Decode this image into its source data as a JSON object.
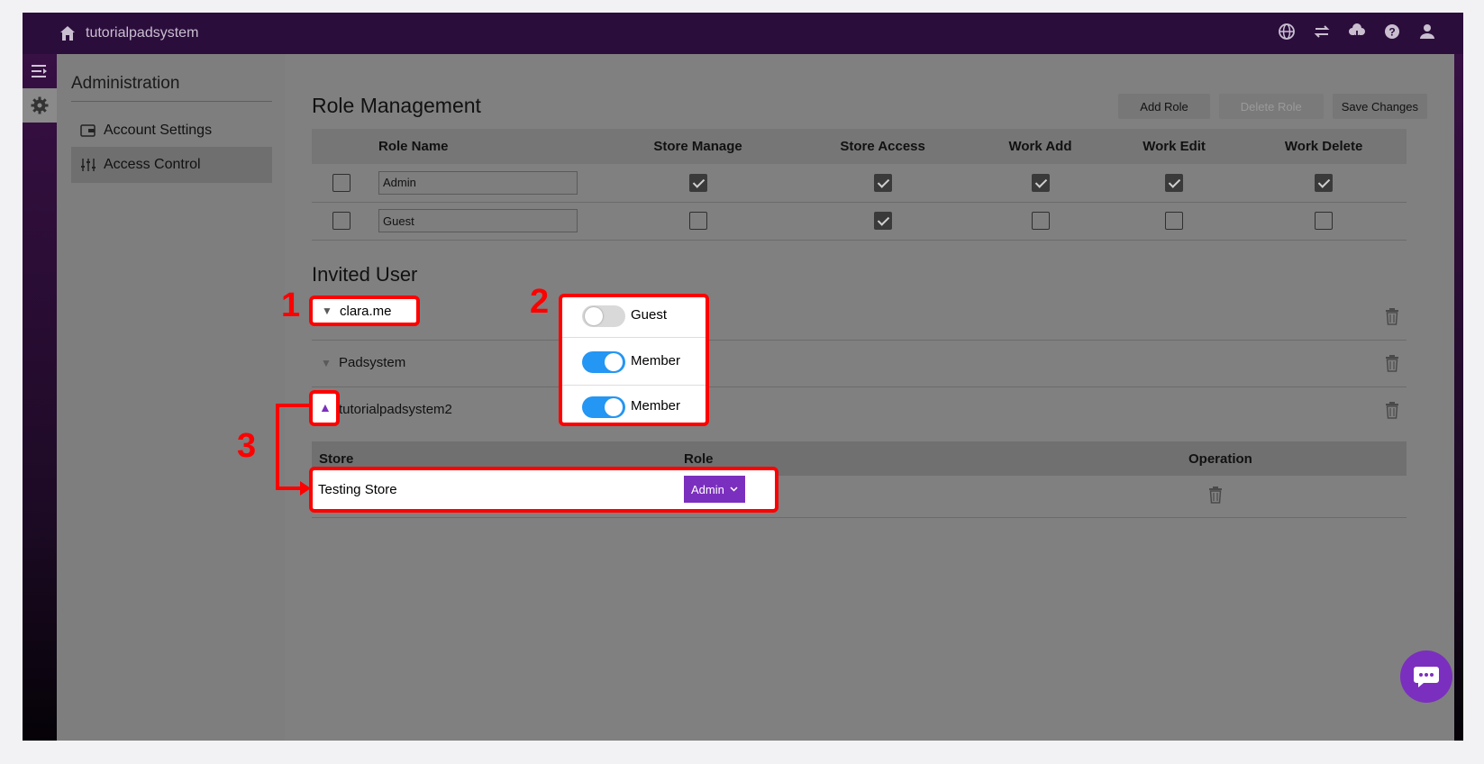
{
  "app": {
    "name": "tutorialpadsystem"
  },
  "sidebar": {
    "title": "Administration",
    "items": [
      {
        "label": "Account Settings",
        "icon": "wallet-icon",
        "active": false
      },
      {
        "label": "Access Control",
        "icon": "sliders-icon",
        "active": true
      }
    ]
  },
  "role_management": {
    "title": "Role Management",
    "buttons": {
      "add": "Add Role",
      "delete": "Delete Role",
      "save": "Save Changes"
    },
    "columns": [
      "Role Name",
      "Store Manage",
      "Store Access",
      "Work Add",
      "Work Edit",
      "Work Delete"
    ],
    "roles": [
      {
        "name": "Admin",
        "perms": [
          true,
          true,
          true,
          true,
          true
        ]
      },
      {
        "name": "Guest",
        "perms": [
          false,
          true,
          false,
          false,
          false
        ]
      }
    ]
  },
  "invited": {
    "title": "Invited User",
    "users": [
      {
        "name": "clara.me",
        "expanded": false,
        "toggle_on": false,
        "role": "Guest"
      },
      {
        "name": "Padsystem",
        "expanded": false,
        "toggle_on": true,
        "role": "Member"
      },
      {
        "name": "tutorialpadsystem2",
        "expanded": true,
        "toggle_on": true,
        "role": "Member"
      }
    ],
    "store_table": {
      "headers": {
        "store": "Store",
        "role": "Role",
        "operation": "Operation"
      },
      "rows": [
        {
          "store": "Testing Store",
          "role": "Admin"
        }
      ]
    }
  },
  "annotations": [
    "1",
    "2",
    "3"
  ],
  "colors": {
    "accent": "#7b2fbe",
    "toggle_on": "#2496f3",
    "annotation": "#ff0000",
    "topbar": "#2b0d3c"
  }
}
